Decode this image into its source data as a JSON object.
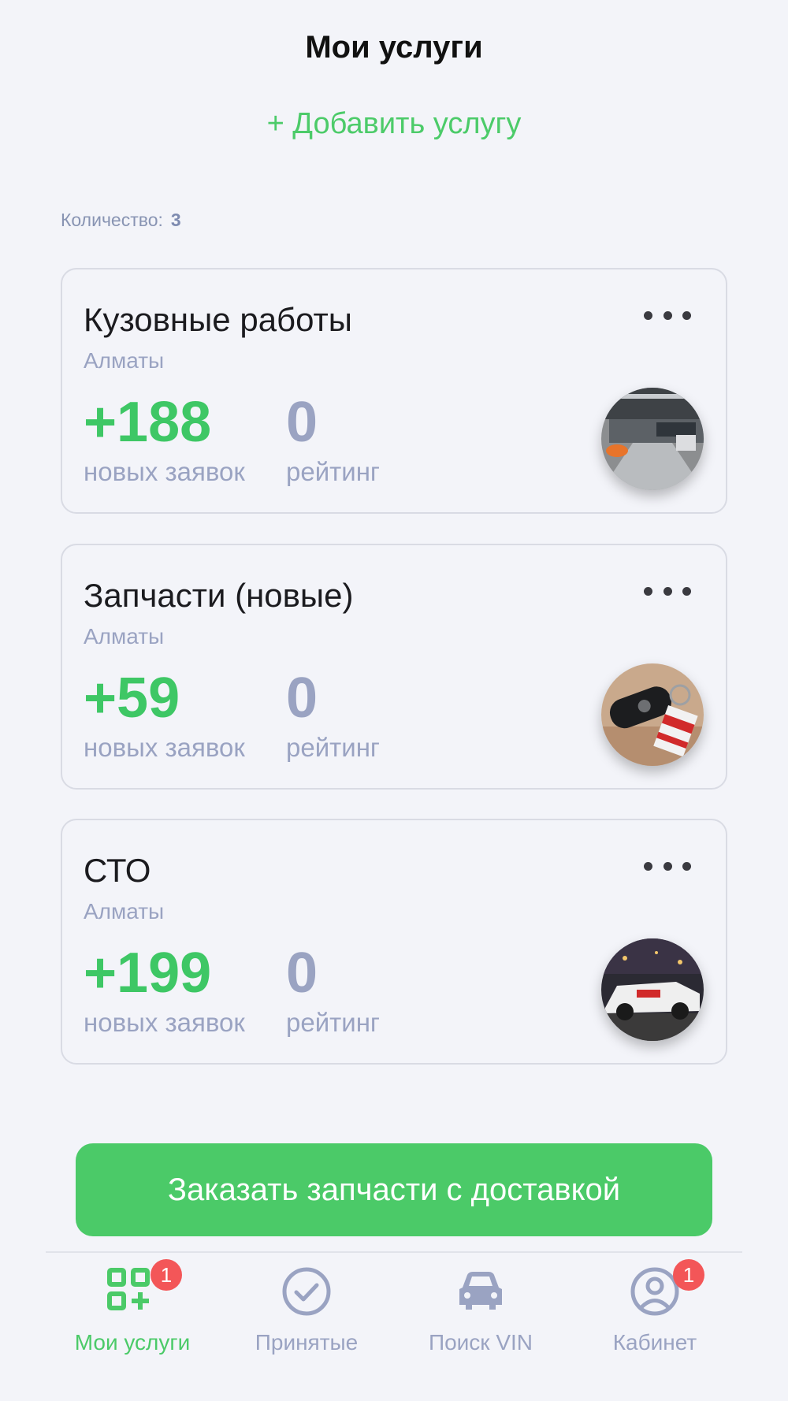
{
  "header": {
    "title": "Мои услуги"
  },
  "add_service": {
    "label": "+ Добавить услугу"
  },
  "count": {
    "label": "Количество:",
    "value": "3"
  },
  "services": [
    {
      "name": "Кузовные работы",
      "city": "Алматы",
      "new_requests": "+188",
      "new_requests_label": "новых заявок",
      "rating": "0",
      "rating_label": "рейтинг"
    },
    {
      "name": "Запчасти (новые)",
      "city": "Алматы",
      "new_requests": "+59",
      "new_requests_label": "новых заявок",
      "rating": "0",
      "rating_label": "рейтинг"
    },
    {
      "name": "СТО",
      "city": "Алматы",
      "new_requests": "+199",
      "new_requests_label": "новых заявок",
      "rating": "0",
      "rating_label": "рейтинг"
    }
  ],
  "order_button": {
    "label": "Заказать запчасти с доставкой"
  },
  "tabbar": {
    "tabs": [
      {
        "label": "Мои услуги",
        "icon": "grid-plus-icon",
        "badge": "1",
        "active": true
      },
      {
        "label": "Принятые",
        "icon": "check-circle-icon",
        "active": false
      },
      {
        "label": "Поиск VIN",
        "icon": "car-icon",
        "active": false
      },
      {
        "label": "Кабинет",
        "icon": "user-circle-icon",
        "badge": "1",
        "active": false
      }
    ]
  },
  "colors": {
    "accent": "#4bca68",
    "muted": "#9aa3c2",
    "badge": "#f35658",
    "background": "#f3f4f9"
  }
}
